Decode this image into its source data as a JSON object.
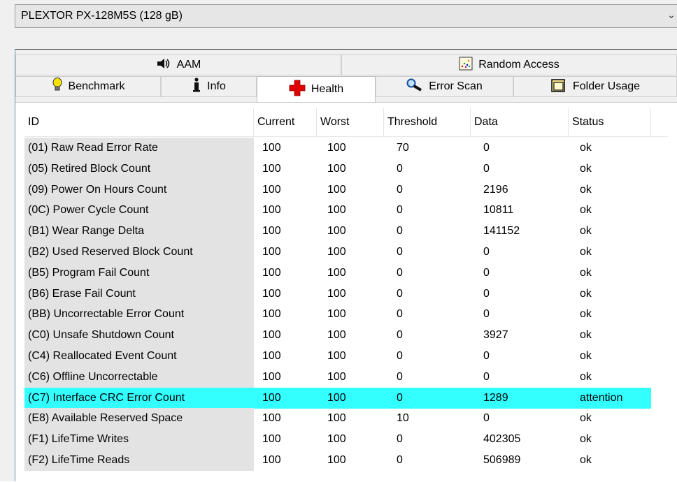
{
  "drive": {
    "selected": "PLEXTOR PX-128M5S (128 gB)"
  },
  "tabs_row1": [
    {
      "label": "AAM",
      "icon": "speaker-icon"
    },
    {
      "label": "Random Access",
      "icon": "random-access-icon"
    }
  ],
  "tabs_row2": [
    {
      "label": "Benchmark",
      "icon": "lightbulb-icon"
    },
    {
      "label": "Info",
      "icon": "info-icon"
    },
    {
      "label": "Health",
      "icon": "health-cross-icon"
    },
    {
      "label": "Error Scan",
      "icon": "magnifier-icon"
    },
    {
      "label": "Folder Usage",
      "icon": "folder-icon"
    }
  ],
  "active_tab": "Health",
  "table": {
    "columns": [
      "ID",
      "Current",
      "Worst",
      "Threshold",
      "Data",
      "Status"
    ],
    "rows": [
      [
        "(01) Raw Read Error Rate",
        "100",
        "100",
        "70",
        "0",
        "ok"
      ],
      [
        "(05) Retired Block Count",
        "100",
        "100",
        "0",
        "0",
        "ok"
      ],
      [
        "(09) Power On Hours Count",
        "100",
        "100",
        "0",
        "2196",
        "ok"
      ],
      [
        "(0C) Power Cycle Count",
        "100",
        "100",
        "0",
        "10811",
        "ok"
      ],
      [
        "(B1) Wear Range Delta",
        "100",
        "100",
        "0",
        "141152",
        "ok"
      ],
      [
        "(B2) Used Reserved Block Count",
        "100",
        "100",
        "0",
        "0",
        "ok"
      ],
      [
        "(B5) Program Fail Count",
        "100",
        "100",
        "0",
        "0",
        "ok"
      ],
      [
        "(B6) Erase Fail Count",
        "100",
        "100",
        "0",
        "0",
        "ok"
      ],
      [
        "(BB) Uncorrectable Error Count",
        "100",
        "100",
        "0",
        "0",
        "ok"
      ],
      [
        "(C0) Unsafe Shutdown Count",
        "100",
        "100",
        "0",
        "3927",
        "ok"
      ],
      [
        "(C4) Reallocated Event Count",
        "100",
        "100",
        "0",
        "0",
        "ok"
      ],
      [
        "(C6) Offline Uncorrectable",
        "100",
        "100",
        "0",
        "0",
        "ok"
      ],
      [
        "(C7) Interface CRC Error Count",
        "100",
        "100",
        "0",
        "1289",
        "attention"
      ],
      [
        "(E8) Available Reserved Space",
        "100",
        "100",
        "10",
        "0",
        "ok"
      ],
      [
        "(F1) LifeTime Writes",
        "100",
        "100",
        "0",
        "402305",
        "ok"
      ],
      [
        "(F2) LifeTime Reads",
        "100",
        "100",
        "0",
        "506989",
        "ok"
      ]
    ],
    "highlighted_row": 12,
    "highlight_color": "#33ffff"
  }
}
